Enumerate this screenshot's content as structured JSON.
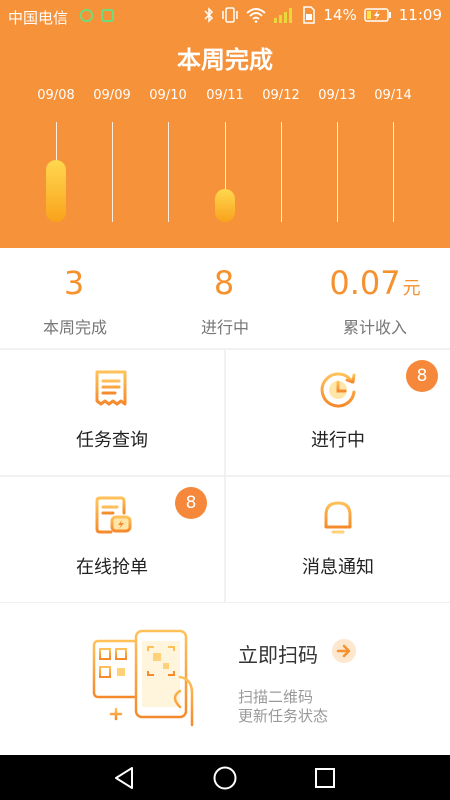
{
  "status_bar": {
    "carrier": "中国电信",
    "battery_percent": "14%",
    "time": "11:09"
  },
  "header": {
    "title": "本周完成",
    "days": [
      {
        "date": "09/08",
        "completion": 0.62
      },
      {
        "date": "09/09",
        "completion": 0
      },
      {
        "date": "09/10",
        "completion": 0
      },
      {
        "date": "09/11",
        "completion": 0.33
      },
      {
        "date": "09/12",
        "completion": 0
      },
      {
        "date": "09/13",
        "completion": 0
      },
      {
        "date": "09/14",
        "completion": 0
      }
    ]
  },
  "stats": [
    {
      "value": "3",
      "unit": "",
      "label": "本周完成"
    },
    {
      "value": "8",
      "unit": "",
      "label": "进行中"
    },
    {
      "value": "0.07",
      "unit": "元",
      "label": "累计收入"
    }
  ],
  "grid": {
    "task_query": {
      "label": "任务查询",
      "icon": "receipt-icon"
    },
    "in_progress": {
      "label": "进行中",
      "icon": "clock-refresh-icon",
      "badge": "8"
    },
    "grab_order": {
      "label": "在线抢单",
      "icon": "order-bolt-icon",
      "badge": "8"
    },
    "notifications": {
      "label": "消息通知",
      "icon": "bell-icon"
    }
  },
  "scan": {
    "title": "立即扫码",
    "subtitle_line1": "扫描二维码",
    "subtitle_line2": "更新任务状态",
    "icon": "phone-scan-qr-icon"
  },
  "colors": {
    "primary": "#f6923a",
    "accent_text": "#f5922f",
    "badge": "#f5883a",
    "bar_top": "#ffd84f",
    "bar_bottom": "#f9a21b"
  },
  "navbar": {
    "icons": [
      "back-icon",
      "home-icon",
      "recents-icon"
    ]
  }
}
